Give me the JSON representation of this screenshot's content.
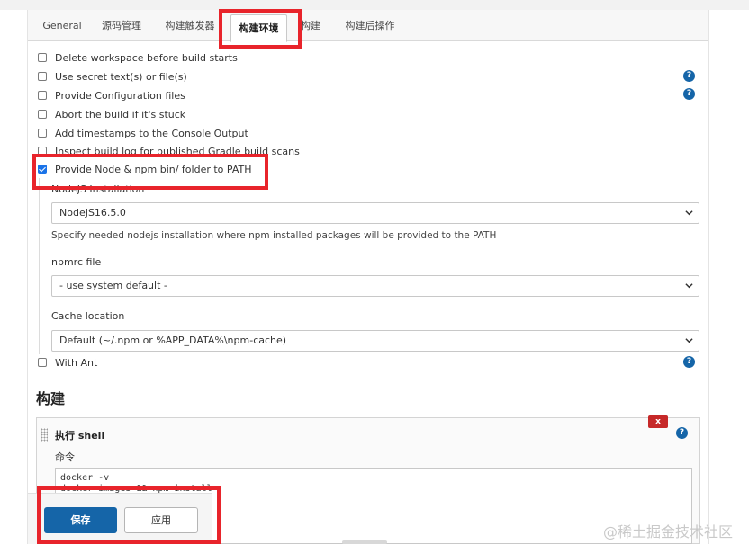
{
  "tabs": [
    {
      "label": "General"
    },
    {
      "label": "源码管理"
    },
    {
      "label": "构建触发器"
    },
    {
      "label": "构建环境"
    },
    {
      "label": "构建"
    },
    {
      "label": "构建后操作"
    }
  ],
  "active_tab": "构建环境",
  "build_env": {
    "options": [
      {
        "label": "Delete workspace before build starts",
        "checked": false,
        "help": false
      },
      {
        "label": "Use secret text(s) or file(s)",
        "checked": false,
        "help": true
      },
      {
        "label": "Provide Configuration files",
        "checked": false,
        "help": true
      },
      {
        "label": "Abort the build if it's stuck",
        "checked": false,
        "help": false
      },
      {
        "label": "Add timestamps to the Console Output",
        "checked": false,
        "help": false
      },
      {
        "label": "Inspect build log for published Gradle build scans",
        "checked": false,
        "help": false
      },
      {
        "label": "Provide Node & npm bin/ folder to PATH",
        "checked": true,
        "help": false
      }
    ],
    "nodejs": {
      "installation_label": "NodeJS Installation",
      "installation_value": "NodeJS16.5.0",
      "installation_desc": "Specify needed nodejs installation where npm installed packages will be provided to the PATH",
      "npmrc_label": "npmrc file",
      "npmrc_value": "- use system default -",
      "cache_label": "Cache location",
      "cache_value": "Default (~/.npm or %APP_DATA%\\npm-cache)"
    },
    "with_ant": {
      "label": "With Ant",
      "checked": false
    }
  },
  "build": {
    "section_title": "构建",
    "step_title": "执行 shell",
    "delete_label": "x",
    "command_label": "命令",
    "command_text": "docker -v\ndocker images && npm install"
  },
  "buttons": {
    "save": "保存",
    "apply": "应用"
  },
  "help_glyph": "?",
  "watermark": "@稀土掘金技术社区",
  "colors": {
    "primary": "#1565a8",
    "danger": "#c62828",
    "highlight": "#e8242b",
    "checked": "#1a73e8"
  }
}
